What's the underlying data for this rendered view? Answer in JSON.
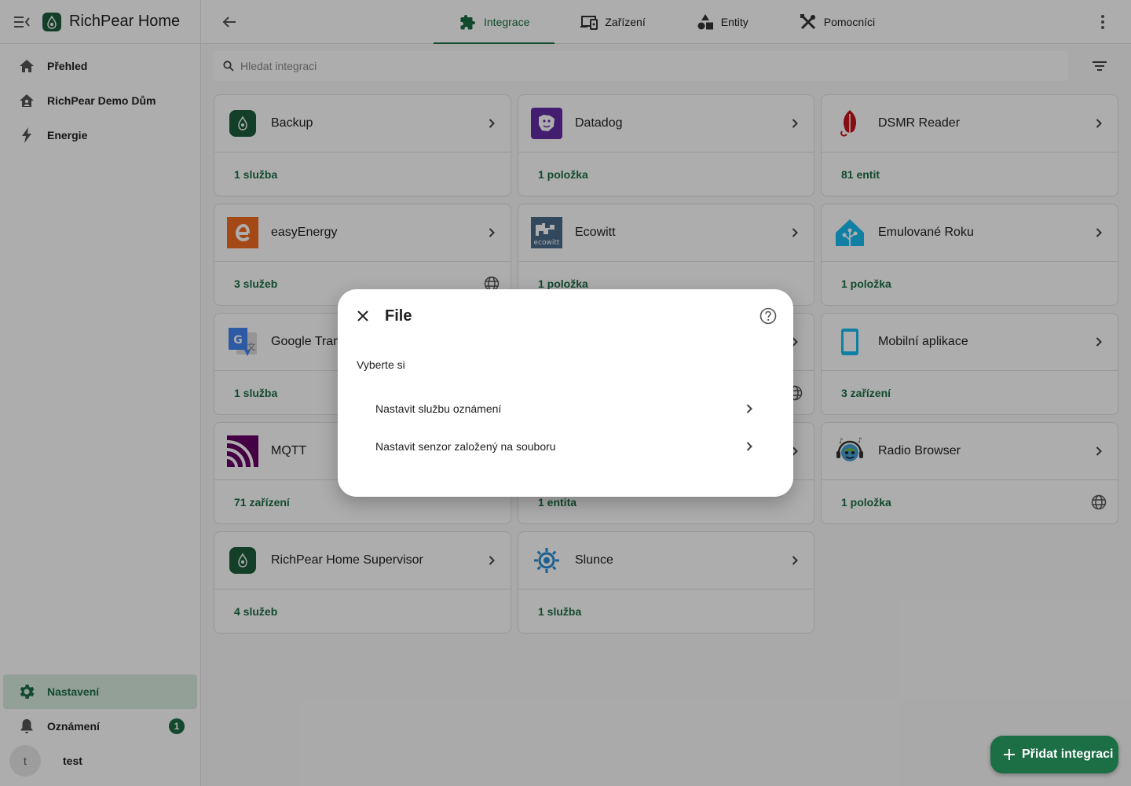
{
  "app": {
    "title": "RichPear Home"
  },
  "sidebar": {
    "items": [
      {
        "label": "Přehled",
        "icon": "home-icon"
      },
      {
        "label": "RichPear Demo Dům",
        "icon": "home-account-icon"
      },
      {
        "label": "Energie",
        "icon": "lightning-icon"
      }
    ],
    "settings_label": "Nastavení",
    "notifications_label": "Oznámení",
    "notifications_count": "1",
    "user_initial": "t",
    "user_name": "test"
  },
  "tabs": [
    {
      "label": "Integrace",
      "icon": "puzzle-icon",
      "active": true
    },
    {
      "label": "Zařízení",
      "icon": "devices-icon",
      "active": false
    },
    {
      "label": "Entity",
      "icon": "shapes-icon",
      "active": false
    },
    {
      "label": "Pomocníci",
      "icon": "tools-icon",
      "active": false
    }
  ],
  "search": {
    "placeholder": "Hledat integraci"
  },
  "cards": [
    {
      "name": "Backup",
      "link": "1 služba",
      "globe": false
    },
    {
      "name": "Datadog",
      "link": "1 položka",
      "globe": false
    },
    {
      "name": "DSMR Reader",
      "link": "81 entit",
      "globe": false
    },
    {
      "name": "easyEnergy",
      "link": "3 služeb",
      "globe": true
    },
    {
      "name": "Ecowitt",
      "link": "1 položka",
      "globe": false
    },
    {
      "name": "Emulované Roku",
      "link": "1 položka",
      "globe": false
    },
    {
      "name": "Google Tran",
      "link": "1 služba",
      "globe": false
    },
    {
      "name": "",
      "link": "",
      "globe": true
    },
    {
      "name": "Mobilní aplikace",
      "link": "3 zařízení",
      "globe": false
    },
    {
      "name": "MQTT",
      "link": "71 zařízení",
      "globe": false
    },
    {
      "name": "",
      "link": "1 entita",
      "globe": false
    },
    {
      "name": "Radio Browser",
      "link": "1 položka",
      "globe": true
    },
    {
      "name": "RichPear Home Supervisor",
      "link": "4 služeb",
      "globe": false
    },
    {
      "name": "Slunce",
      "link": "1 služba",
      "globe": false
    }
  ],
  "fab": {
    "label": "Přidat integraci"
  },
  "dialog": {
    "title": "File",
    "subtitle": "Vyberte si",
    "options": [
      {
        "label": "Nastavit službu oznámení"
      },
      {
        "label": "Nastavit senzor založený na souboru"
      }
    ]
  },
  "colors": {
    "accent": "#1c6e45",
    "active_bg": "#d9ecdf"
  }
}
